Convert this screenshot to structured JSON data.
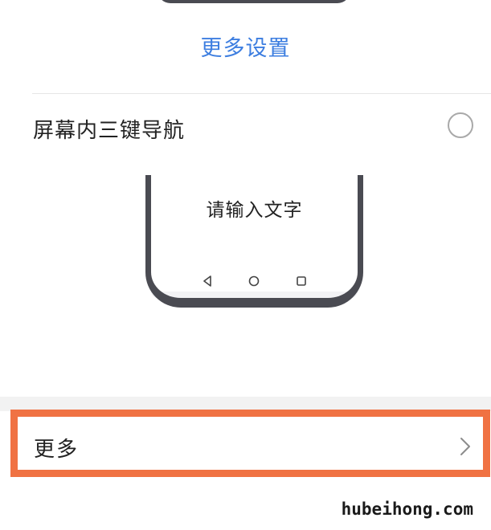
{
  "settings": {
    "more_settings_link": "更多设置",
    "nav_option": {
      "label": "屏幕内三键导航",
      "selected": false
    },
    "preview": {
      "input_text": "请输入文字",
      "nav_keys": [
        "back-icon",
        "home-icon",
        "recents-icon"
      ]
    },
    "more_row": {
      "label": "更多",
      "highlight_color": "#f07243"
    },
    "accent_color": "#3d7ee0"
  },
  "watermark": "hubeihong.com"
}
